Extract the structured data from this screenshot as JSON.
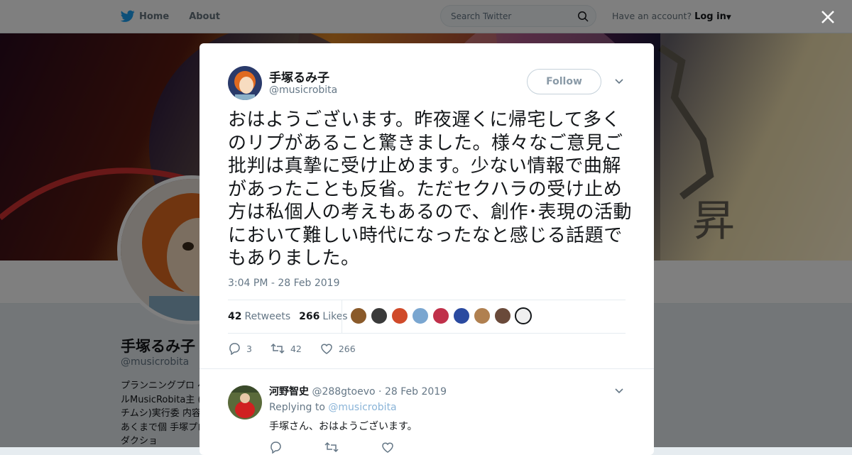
{
  "nav": {
    "home_label": "Home",
    "about_label": "About",
    "search_placeholder": "Search Twitter",
    "account_prompt": "Have an account?",
    "login_label": "Log in"
  },
  "profile": {
    "name": "手塚るみ子",
    "handle": "@musicrobita",
    "bio": "プランニングプロ ベルMusicRobita主 (キチムシ)実行委 内容はあくまで個 手塚プロダクショ"
  },
  "tweet": {
    "author_name": "手塚るみ子",
    "author_handle": "@musicrobita",
    "follow_label": "Follow",
    "text": "おはようございます。昨夜遅くに帰宅して多くのリプがあること驚きました。様々なご意見ご批判は真摯に受け止めます。少ない情報で曲解があったことも反省。ただセクハラの受け止め方は私個人の考えもあるので、創作･表現の活動において難しい時代になったなと感じる話題でもありました。",
    "timestamp": "3:04 PM - 28 Feb 2019",
    "retweets_count": "42",
    "retweets_label": "Retweets",
    "likes_count": "266",
    "likes_label": "Likes",
    "replies_action_count": "3",
    "retweets_action_count": "42",
    "likes_action_count": "266"
  },
  "likers": [
    "#8a5a2a",
    "#3a3a3a",
    "#d04a2a",
    "#7aa6d0",
    "#c0304a",
    "#2a4aa0",
    "#b08050",
    "#6a4a3a",
    "#f0f0f0"
  ],
  "reply": {
    "name": "河野智史",
    "handle": "@288gtoevo",
    "separator": "·",
    "date": "28 Feb 2019",
    "replying_prefix": "Replying to",
    "replying_handle": "@musicrobita",
    "text": "手塚さん、おはようございます。"
  },
  "colors": {
    "twitter_blue": "#1da1f2",
    "text_primary": "#14171a",
    "text_secondary": "#657786"
  }
}
